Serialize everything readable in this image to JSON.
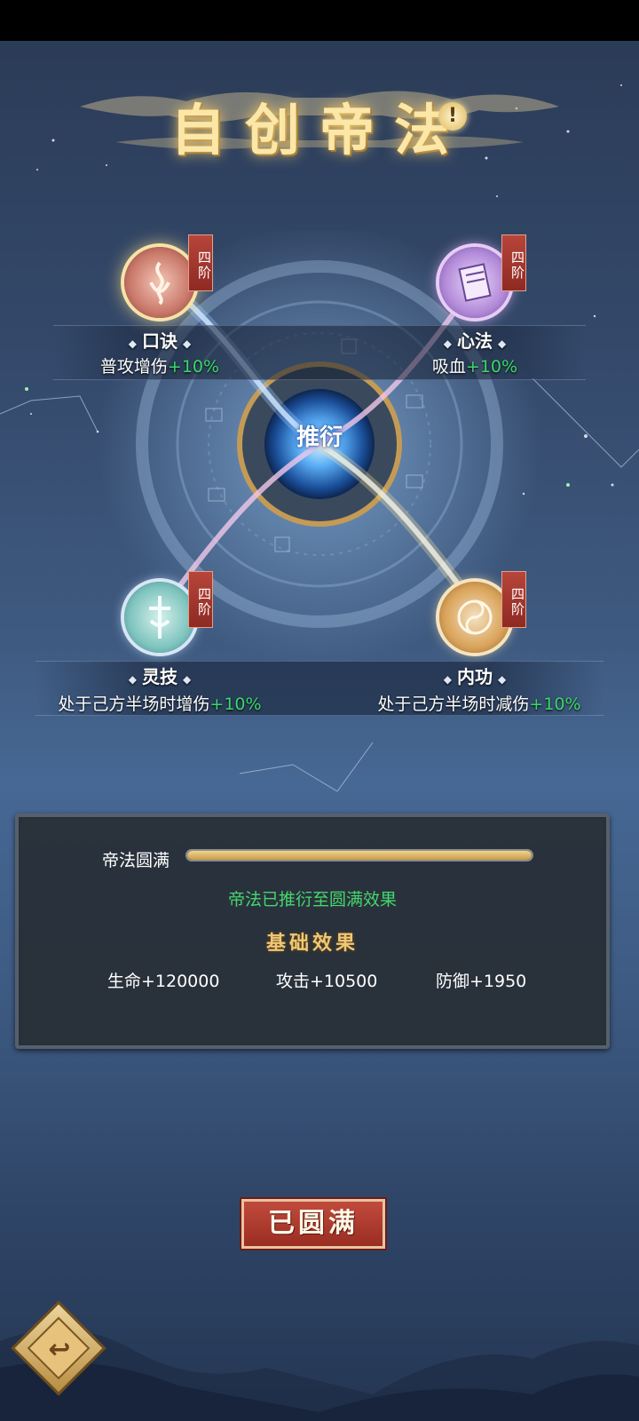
{
  "title": "自创帝法",
  "info_icon": "info-icon",
  "core_label": "推衍",
  "nodes": [
    {
      "name": "口诀",
      "rank": "四阶",
      "effect_text": "普攻增伤",
      "effect_value": "+10%",
      "icon": "flame-glyph-icon",
      "color": "#c9786a"
    },
    {
      "name": "心法",
      "rank": "四阶",
      "effect_text": "吸血",
      "effect_value": "+10%",
      "icon": "scroll-icon",
      "color": "#b28ad9"
    },
    {
      "name": "灵技",
      "rank": "四阶",
      "effect_text": "处于己方半场时增伤",
      "effect_value": "+10%",
      "icon": "sword-glyph-icon",
      "color": "#7fc4bf"
    },
    {
      "name": "内功",
      "rank": "四阶",
      "effect_text": "处于己方半场时减伤",
      "effect_value": "+10%",
      "icon": "taiji-icon",
      "color": "#d9a35a"
    }
  ],
  "panel": {
    "progress_label": "帝法圆满",
    "progress": 1.0,
    "status_text": "帝法已推衍至圆满效果",
    "subtitle": "基础效果",
    "stats": [
      "生命+120000",
      "攻击+10500",
      "防御+1950"
    ]
  },
  "complete_button": "已圆满",
  "back_button_icon": "back-icon",
  "colors": {
    "accent_green": "#39d96b",
    "rank_red": "#9a2d22",
    "title_gold": "#fbe7a8"
  }
}
